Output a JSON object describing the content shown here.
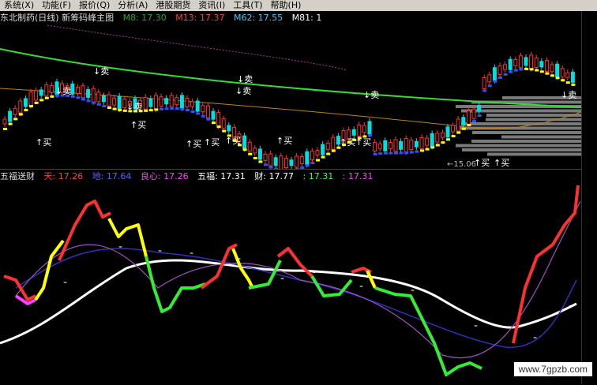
{
  "menu": [
    {
      "label": "系统",
      "key": "X"
    },
    {
      "label": "功能",
      "key": "F"
    },
    {
      "label": "报价",
      "key": "Q"
    },
    {
      "label": "分析",
      "key": "A"
    },
    {
      "label": "港股期货",
      "key": ""
    },
    {
      "label": "资讯",
      "key": "I"
    },
    {
      "label": "工具",
      "key": "T"
    },
    {
      "label": "帮助",
      "key": "H"
    }
  ],
  "main": {
    "title": "东北制药(日线) 新筹码峰主图",
    "ma": [
      {
        "label": "M8: 17.30",
        "color": "#22aa22"
      },
      {
        "label": "M13: 17.37",
        "color": "#ff4040"
      },
      {
        "label": "M62: 17.55",
        "color": "#40c8ff"
      },
      {
        "label": "M81: 1",
        "color": "#ffffff"
      }
    ],
    "low_label": "←15.06",
    "buy_label": "买",
    "sell_label": "卖",
    "sell_signals": [
      "↓卖",
      "↓卖",
      "↓卖",
      "↓卖",
      "↓卖",
      "↓卖",
      "↓卖"
    ],
    "buy_signals": [
      "↑买",
      "↑买",
      "↑买",
      "↑买",
      "↑买",
      "↑买",
      "↑买",
      "↑买",
      "↑买",
      "↑买"
    ]
  },
  "sub": {
    "title": "五福送财",
    "values": [
      {
        "label": "天: 17.26",
        "color": "#ff4040"
      },
      {
        "label": "地: 17.64",
        "color": "#6060ff"
      },
      {
        "label": "良心: 17.26",
        "color": "#ff40ff"
      },
      {
        "label": "五福: 17.31",
        "color": "#ffffff"
      },
      {
        "label": "财: 17.77",
        "color": "#ffffff"
      },
      {
        "label": ": 17.31",
        "color": "#40ff40"
      },
      {
        "label": ": 17.31",
        "color": "#ff40ff"
      }
    ]
  },
  "watermark": "www.7gpzb.com",
  "colors": {
    "up": "#ff3030",
    "down": "#00e0e0",
    "yellow": "#ffff00",
    "green": "#33ee33",
    "white": "#ffffff"
  }
}
